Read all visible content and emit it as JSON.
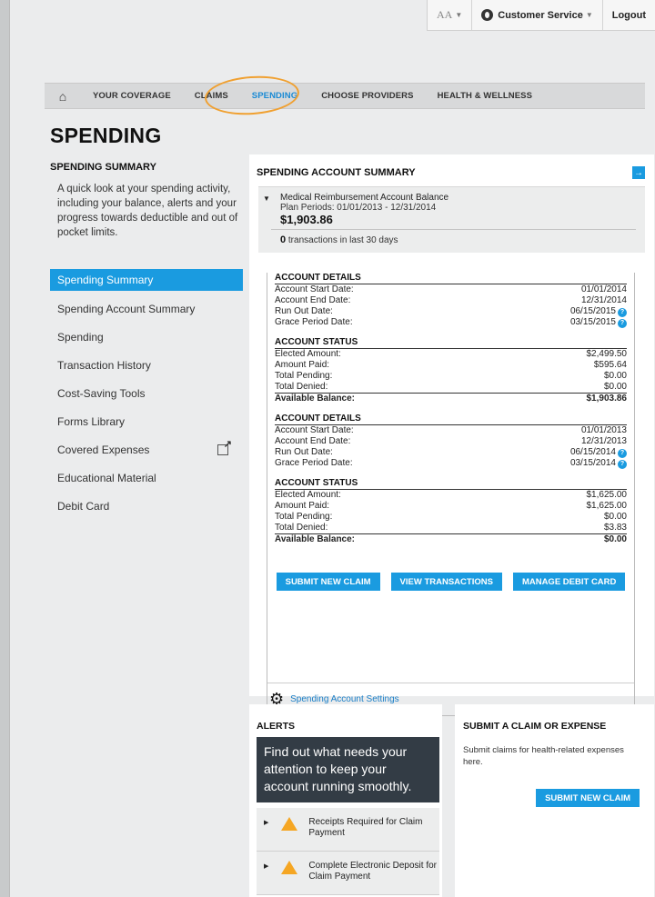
{
  "utility": {
    "text_size": "AA",
    "customer_service": "Customer Service",
    "logout": "Logout"
  },
  "nav": {
    "items": [
      "YOUR COVERAGE",
      "CLAIMS",
      "SPENDING",
      "CHOOSE PROVIDERS",
      "HEALTH & WELLNESS"
    ],
    "active": "SPENDING"
  },
  "page_title": "SPENDING",
  "sidebar": {
    "heading": "SPENDING SUMMARY",
    "description": "A quick look at your spending activity, including your balance, alerts and your progress towards deductible and out of pocket limits.",
    "items": [
      "Spending Summary",
      "Spending Account Summary",
      "Spending",
      "Transaction History",
      "Cost-Saving Tools",
      "Forms Library",
      "Covered Expenses",
      "Educational Material",
      "Debit Card"
    ]
  },
  "account_summary": {
    "heading": "SPENDING ACCOUNT SUMMARY",
    "account_name": "Medical Reimbursement Account Balance",
    "plan_periods": "Plan Periods: 01/01/2013 - 12/31/2014",
    "balance": "$1,903.86",
    "tx_count": "0",
    "tx_label": "transactions in last 30 days"
  },
  "periods": [
    {
      "details_heading": "ACCOUNT DETAILS",
      "start_label": "Account Start Date:",
      "start": "01/01/2014",
      "end_label": "Account End Date:",
      "end": "12/31/2014",
      "runout_label": "Run Out Date:",
      "runout": "06/15/2015",
      "grace_label": "Grace Period Date:",
      "grace": "03/15/2015",
      "status_heading": "ACCOUNT STATUS",
      "elected_label": "Elected Amount:",
      "elected": "$2,499.50",
      "paid_label": "Amount Paid:",
      "paid": "$595.64",
      "pending_label": "Total Pending:",
      "pending": "$0.00",
      "denied_label": "Total Denied:",
      "denied": "$0.00",
      "available_label": "Available Balance:",
      "available": "$1,903.86"
    },
    {
      "details_heading": "ACCOUNT DETAILS",
      "start_label": "Account Start Date:",
      "start": "01/01/2013",
      "end_label": "Account End Date:",
      "end": "12/31/2013",
      "runout_label": "Run Out Date:",
      "runout": "06/15/2014",
      "grace_label": "Grace Period Date:",
      "grace": "03/15/2014",
      "status_heading": "ACCOUNT STATUS",
      "elected_label": "Elected Amount:",
      "elected": "$1,625.00",
      "paid_label": "Amount Paid:",
      "paid": "$1,625.00",
      "pending_label": "Total Pending:",
      "pending": "$0.00",
      "denied_label": "Total Denied:",
      "denied": "$3.83",
      "available_label": "Available Balance:",
      "available": "$0.00"
    }
  ],
  "buttons": {
    "submit_claim": "SUBMIT NEW CLAIM",
    "view_transactions": "VIEW TRANSACTIONS",
    "manage_debit": "MANAGE DEBIT CARD"
  },
  "settings_link": "Spending Account Settings",
  "alerts": {
    "heading": "ALERTS",
    "banner": "Find out what needs your attention to keep your account running smoothly.",
    "items": [
      "Receipts Required for Claim Payment",
      "Complete Electronic Deposit for Claim Payment"
    ]
  },
  "submit_box": {
    "heading": "SUBMIT A CLAIM OR EXPENSE",
    "description": "Submit claims for health-related expenses here.",
    "button": "SUBMIT NEW CLAIM"
  },
  "colors": {
    "accent": "#1a9be0",
    "alert_banner": "#333c45",
    "warning": "#f5a623",
    "highlight_circle": "#f0a030"
  }
}
